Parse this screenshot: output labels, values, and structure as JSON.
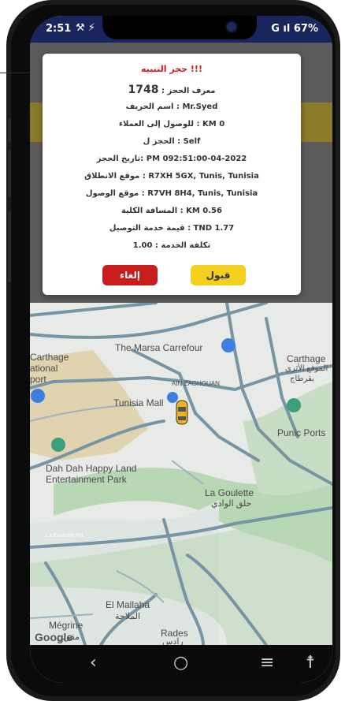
{
  "status_bar": {
    "time": "2:51",
    "left_icons": "⚒ ⚡",
    "right_text": "G ıl 67%"
  },
  "modal": {
    "title": "حجز التنبيه !!!",
    "booking_id_label": "معرف الحجز :",
    "booking_id_value": "1748",
    "driver_line": "اسم الحريف : Mr.Syed",
    "distance_to_client": "للوصول إلى العملاء : KM 0",
    "booking_for": "الحجز ل : Self",
    "booking_date": "تاريخ الحجز: PM 092:51:00-04-2022",
    "pickup": "موقع الانطلاق : R7XH 5GX, Tunis, Tunisia",
    "dropoff": "موقع الوصول : R7VH 8H4, Tunis, Tunisia",
    "total_distance": "المسافة الكلية : KM 0.56",
    "delivery_fee": "قيمة خدمة التوصيل : TND 1.77",
    "service_cost": "تكلفة الخدمة : 1.00",
    "cancel_label": "إلغاء",
    "accept_label": "قبول"
  },
  "map": {
    "labels": {
      "marsa": "The Marsa Carrefour",
      "carthage_airport_1": "Carthage",
      "carthage_airport_2": "ational",
      "carthage_airport_3": "port",
      "carthage_r1": "Carthage",
      "carthage_r2": "الموقع الأثري",
      "carthage_r3": "بقرطاج",
      "ain": "AIN ZAGHOUAN",
      "tunisia_mall": "Tunisia Mall",
      "punic": "Punic Ports",
      "dah1": "Dah Dah Happy Land",
      "dah2": "Entertainment Park",
      "goulette1": "La Goulette",
      "goulette2": "حلق الوادي",
      "goulette_rd": "La Goulette Rd",
      "mallaha1": "El Mallaha",
      "mallaha2": "الملاحة",
      "megrine1": "Mégrine",
      "megrine2": "مقرين",
      "rades1": "Rades",
      "rades2": "رادس",
      "google": "Google"
    }
  },
  "nav_bar": {
    "back": "‹",
    "home": "○",
    "menu": "≡",
    "accessibility": "☨"
  }
}
